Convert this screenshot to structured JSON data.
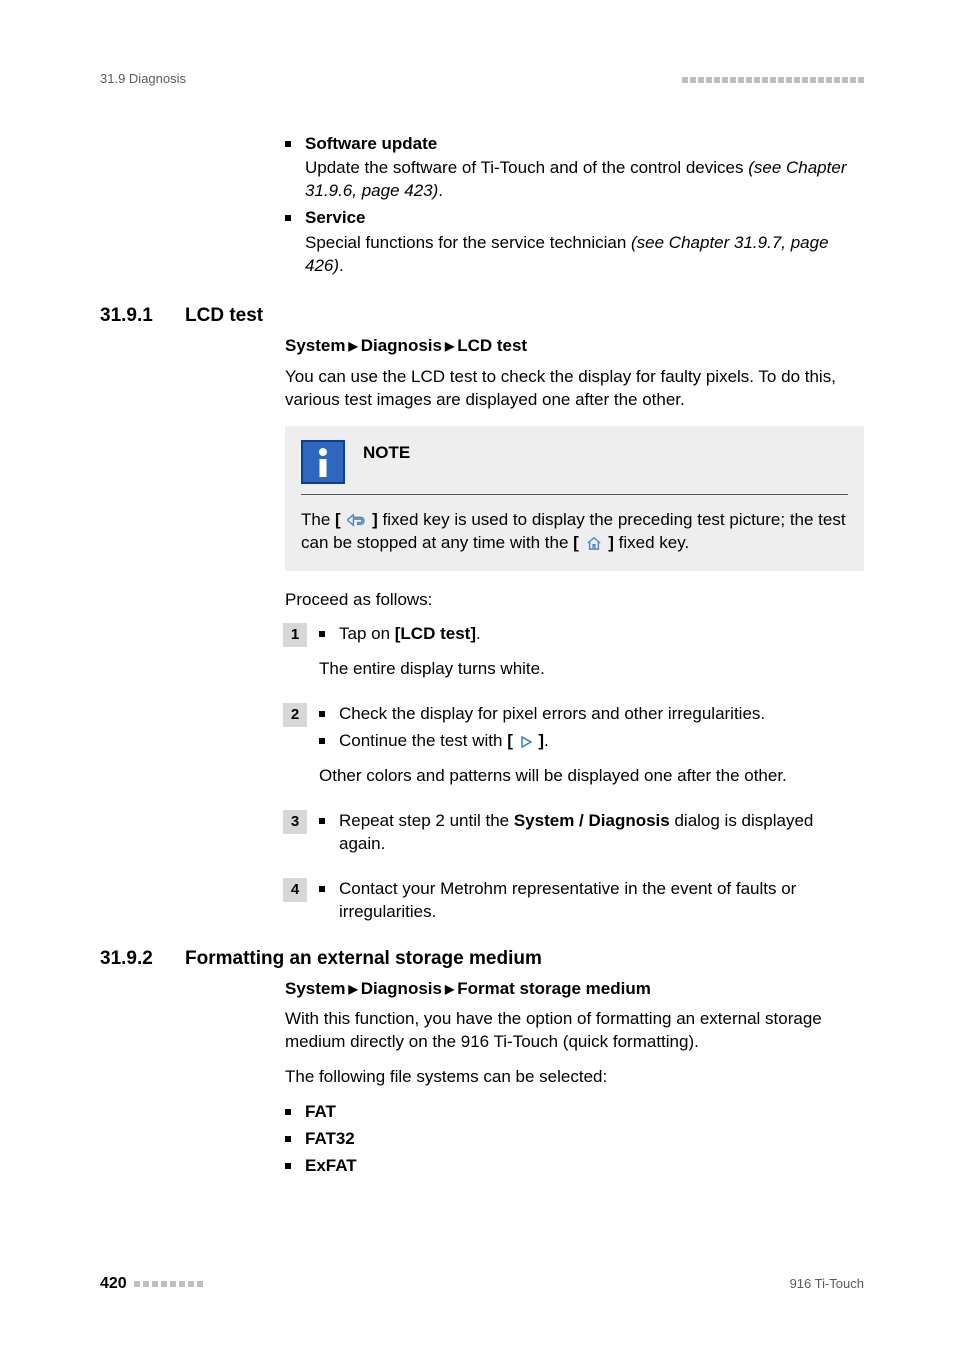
{
  "header": {
    "left": "31.9 Diagnosis"
  },
  "intro_list": [
    {
      "title": "Software update",
      "body_parts": [
        "Update the software of Ti-Touch and of the control devices ",
        "(see Chapter 31.9.6, page 423)",
        "."
      ]
    },
    {
      "title": "Service",
      "body_parts": [
        "Special functions for the service technician ",
        "(see Chapter 31.9.7, page 426)",
        "."
      ]
    }
  ],
  "section1": {
    "num": "31.9.1",
    "title": "LCD test",
    "breadcrumb": [
      "System",
      "Diagnosis",
      "LCD test"
    ],
    "para1": "You can use the LCD test to check the display for faulty pixels. To do this, various test images are displayed one after the other.",
    "note_title": "NOTE",
    "note_text_a": "The ",
    "note_text_b": " fixed key is used to display the preceding test picture; the test can be stopped at any time with the ",
    "note_text_c": " fixed key.",
    "proceed": "Proceed as follows:",
    "steps": {
      "s1": {
        "b1a": "Tap on ",
        "b1b": "[LCD test]",
        "b1c": ".",
        "result": "The entire display turns white."
      },
      "s2": {
        "b1": "Check the display for pixel errors and other irregularities.",
        "b2a": "Continue the test with ",
        "b2b": ".",
        "result": "Other colors and patterns will be displayed one after the other."
      },
      "s3": {
        "b1a": "Repeat step 2 until the ",
        "b1b": "System / Diagnosis",
        "b1c": " dialog is displayed again."
      },
      "s4": {
        "b1": "Contact your Metrohm representative in the event of faults or irregularities."
      }
    }
  },
  "section2": {
    "num": "31.9.2",
    "title": "Formatting an external storage medium",
    "breadcrumb": [
      "System",
      "Diagnosis",
      "Format storage medium"
    ],
    "para1": "With this function, you have the option of formatting an external storage medium directly on the 916 Ti-Touch (quick formatting).",
    "para2": "The following file systems can be selected:",
    "fs": [
      "FAT",
      "FAT32",
      "ExFAT"
    ]
  },
  "footer": {
    "page": "420",
    "doc": "916 Ti-Touch"
  }
}
